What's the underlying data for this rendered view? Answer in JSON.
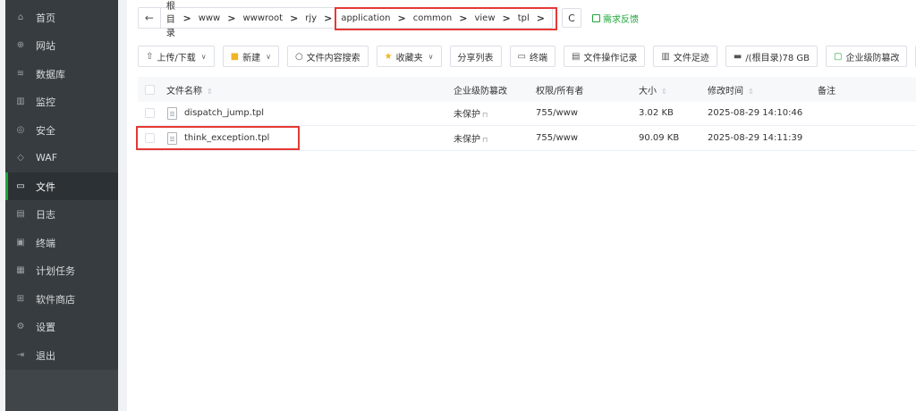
{
  "sidebar": {
    "items": [
      {
        "label": "首页",
        "icon": "⌂",
        "icon_name": "home-icon"
      },
      {
        "label": "网站",
        "icon": "⊕",
        "icon_name": "globe-icon"
      },
      {
        "label": "数据库",
        "icon": "≋",
        "icon_name": "database-icon"
      },
      {
        "label": "监控",
        "icon": "▥",
        "icon_name": "monitor-icon"
      },
      {
        "label": "安全",
        "icon": "◎",
        "icon_name": "shield-icon"
      },
      {
        "label": "WAF",
        "icon": "◇",
        "icon_name": "waf-shield-icon"
      },
      {
        "label": "文件",
        "icon": "▭",
        "icon_name": "folder-icon"
      },
      {
        "label": "日志",
        "icon": "▤",
        "icon_name": "log-icon"
      },
      {
        "label": "终端",
        "icon": "▣",
        "icon_name": "terminal-icon"
      },
      {
        "label": "计划任务",
        "icon": "▦",
        "icon_name": "schedule-icon"
      },
      {
        "label": "软件商店",
        "icon": "⊞",
        "icon_name": "apps-icon"
      },
      {
        "label": "设置",
        "icon": "⚙",
        "icon_name": "gear-icon"
      },
      {
        "label": "退出",
        "icon": "⇥",
        "icon_name": "logout-icon"
      }
    ],
    "active": "文件"
  },
  "breadcrumb": {
    "back_icon": "←",
    "segments": [
      "根目录",
      "www",
      "wwwroot",
      "rjy",
      "application",
      "common",
      "view",
      "tpl"
    ],
    "separator": ">"
  },
  "refresh_icon": "C",
  "feedback_label": "需求反馈",
  "toolbar": {
    "upload_label": "上传/下载",
    "new_label": "新建",
    "search_label": "文件内容搜索",
    "favorites_label": "收藏夹",
    "share_label": "分享列表",
    "terminal_label": "终端",
    "oplog_label": "文件操作记录",
    "footprint_label": "文件足迹",
    "disk_label": "/(根目录)78 GB",
    "protect_label": "企业级防篡改"
  },
  "table": {
    "headers": {
      "name": "文件名称",
      "protect": "企业级防篡改",
      "perm": "权限/所有者",
      "size": "大小",
      "mtime": "修改时间",
      "remark": "备注"
    },
    "rows": [
      {
        "name": "dispatch_jump.tpl",
        "protect": "未保护",
        "perm": "755/www",
        "size": "3.02 KB",
        "mtime": "2025-08-29 14:10:46",
        "remark": ""
      },
      {
        "name": "think_exception.tpl",
        "protect": "未保护",
        "perm": "755/www",
        "size": "90.09 KB",
        "mtime": "2025-08-29 14:11:39",
        "remark": ""
      }
    ]
  },
  "colors": {
    "accent": "#20a53a",
    "highlight": "#e53935",
    "sidebar": "#363c40"
  }
}
